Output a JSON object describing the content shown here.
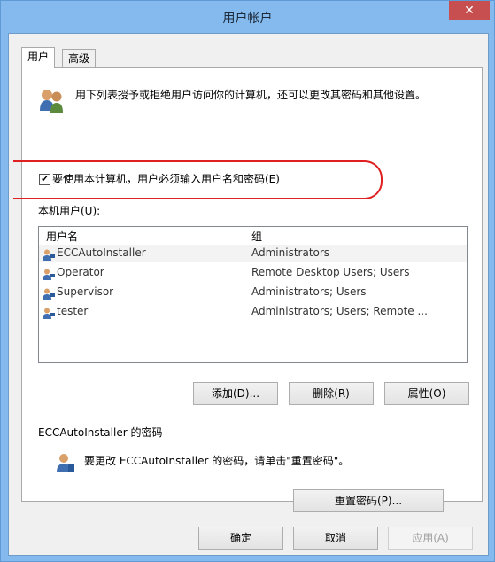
{
  "window": {
    "title": "用户帐户",
    "close_glyph": "✕"
  },
  "tabs": [
    {
      "label": "用户",
      "active": true
    },
    {
      "label": "高级",
      "active": false
    }
  ],
  "intro_text": "用下列表授予或拒绝用户访问你的计算机，还可以更改其密码和其他设置。",
  "require_password": {
    "label": "要使用本计算机，用户必须输入用户名和密码(E)",
    "checked": true,
    "check_glyph": "✔"
  },
  "users_list": {
    "label": "本机用户(U):",
    "headers": [
      "用户名",
      "组"
    ],
    "rows": [
      {
        "name": "ECCAutoInstaller",
        "group": "Administrators",
        "selected": true
      },
      {
        "name": "Operator",
        "group": "Remote Desktop Users; Users",
        "selected": false
      },
      {
        "name": "Supervisor",
        "group": "Administrators; Users",
        "selected": false
      },
      {
        "name": "tester",
        "group": "Administrators; Users; Remote ...",
        "selected": false
      }
    ]
  },
  "list_buttons": {
    "add": "添加(D)...",
    "remove": "删除(R)",
    "properties": "属性(O)"
  },
  "password_section": {
    "title": "ECCAutoInstaller 的密码",
    "text": "要更改 ECCAutoInstaller 的密码，请单击\"重置密码\"。",
    "reset_button": "重置密码(P)..."
  },
  "footer": {
    "ok": "确定",
    "cancel": "取消",
    "apply": "应用(A)"
  },
  "icons": {
    "users": "users-icon",
    "user": "user-icon",
    "key": "key-user-icon"
  },
  "colors": {
    "frame": "#84baee",
    "close": "#c74f4f",
    "highlight": "#e02020"
  }
}
